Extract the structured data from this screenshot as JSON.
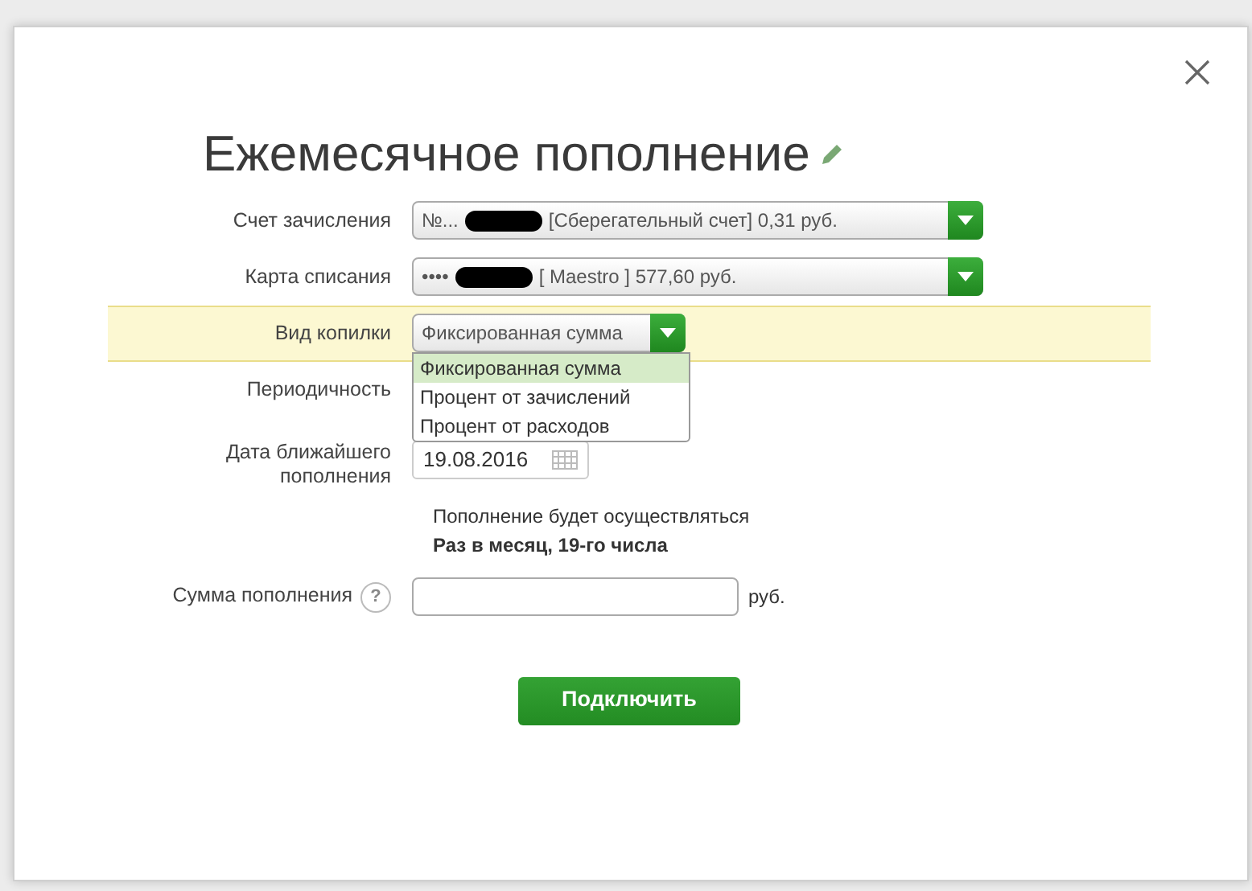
{
  "dialog": {
    "title": "Ежемесячное пополнение",
    "fields": [
      {
        "kind": "select",
        "label": "Счет зачисления",
        "prefix": "№...",
        "redacted": true,
        "value": "[Сберегательный счет] 0,31  руб."
      },
      {
        "kind": "select",
        "label": "Карта списания",
        "prefix": "••••",
        "redacted": true,
        "value": "[ Maestro ] 577,60    руб."
      },
      {
        "kind": "dropdown",
        "label": "Вид копилки",
        "highlighted": true,
        "value": "Фиксированная сумма",
        "expanded": true,
        "options": [
          {
            "label": "Фиксированная сумма",
            "selected": true
          },
          {
            "label": "Процент от зачислений",
            "selected": false
          },
          {
            "label": "Процент от расходов",
            "selected": false
          }
        ]
      },
      {
        "kind": "empty",
        "label": "Периодичность"
      },
      {
        "kind": "date",
        "label": "Дата ближайшего пополнения",
        "value": "19.08.2016"
      },
      {
        "kind": "info",
        "line1": "Пополнение будет осуществляться",
        "line2": "Раз в месяц, 19-го числа"
      },
      {
        "kind": "amount",
        "label": "Сумма пополнения",
        "help": "?",
        "unit": "руб."
      }
    ],
    "submit": "Подключить"
  }
}
